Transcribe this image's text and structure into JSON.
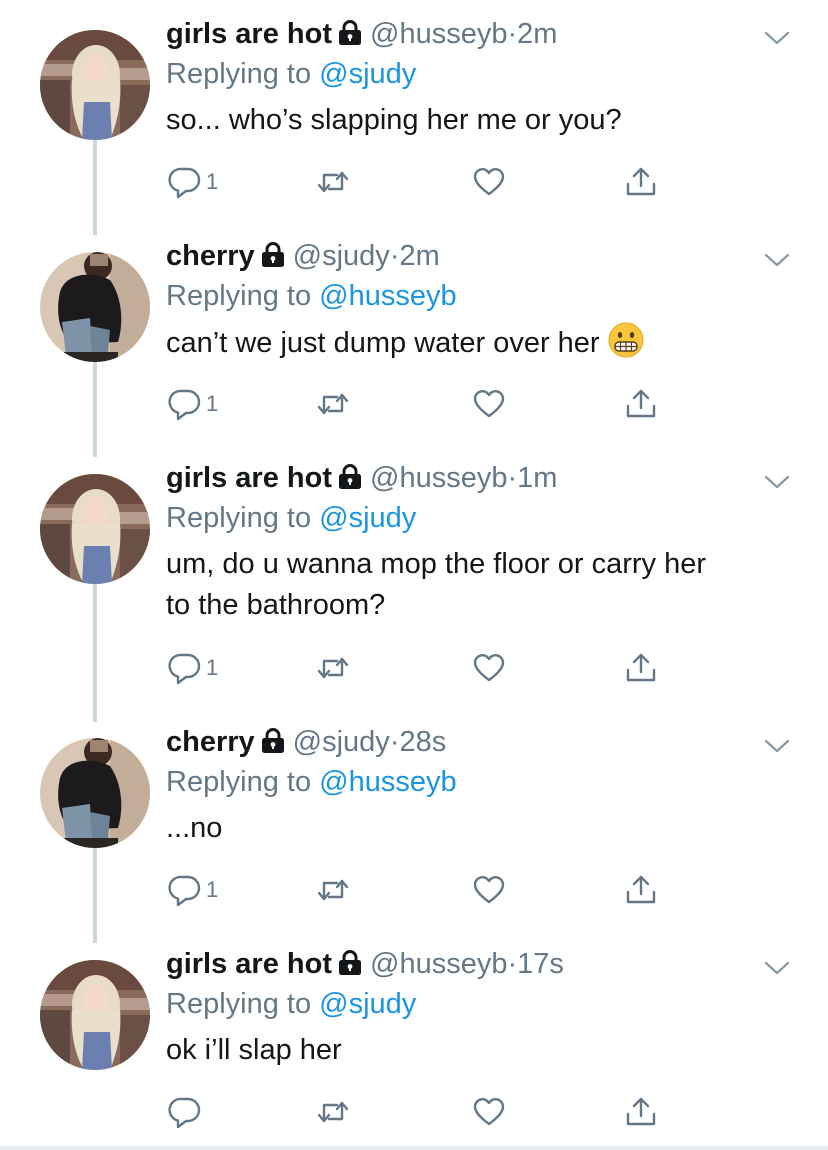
{
  "icons": {
    "lock": "lock-icon",
    "reply": "reply-icon",
    "retweet": "retweet-icon",
    "like": "heart-icon",
    "share": "share-icon",
    "caret": "chevron-down-icon",
    "emoji": "grimacing-face-emoji"
  },
  "colors": {
    "text": "#14171a",
    "secondary": "#657786",
    "link": "#1b95e0",
    "thread_line": "#ccd6dd"
  },
  "thread": [
    {
      "display_name": "girls are hot",
      "handle": "@husseyb",
      "separator": "·",
      "time": "2m",
      "replying_prefix": "Replying to",
      "replying_to": "@sjudy",
      "text": "so... who’s slapping her me or you?",
      "reply_count": "1"
    },
    {
      "display_name": "cherry",
      "handle": "@sjudy",
      "separator": "·",
      "time": "2m",
      "replying_prefix": "Replying to",
      "replying_to": "@husseyb",
      "text": "can’t we just dump water over her",
      "reply_count": "1"
    },
    {
      "display_name": "girls are hot",
      "handle": "@husseyb",
      "separator": "·",
      "time": "1m",
      "replying_prefix": "Replying to",
      "replying_to": "@sjudy",
      "text_line1": "um, do u wanna mop the floor or carry her",
      "text_line2": "to the bathroom?",
      "reply_count": "1"
    },
    {
      "display_name": "cherry",
      "handle": "@sjudy",
      "separator": "·",
      "time": "28s",
      "replying_prefix": "Replying to",
      "replying_to": "@husseyb",
      "text": "...no",
      "reply_count": "1"
    },
    {
      "display_name": "girls are hot",
      "handle": "@husseyb",
      "separator": "·",
      "time": "17s",
      "replying_prefix": "Replying to",
      "replying_to": "@sjudy",
      "text": "ok i’ll slap her",
      "reply_count": ""
    }
  ]
}
